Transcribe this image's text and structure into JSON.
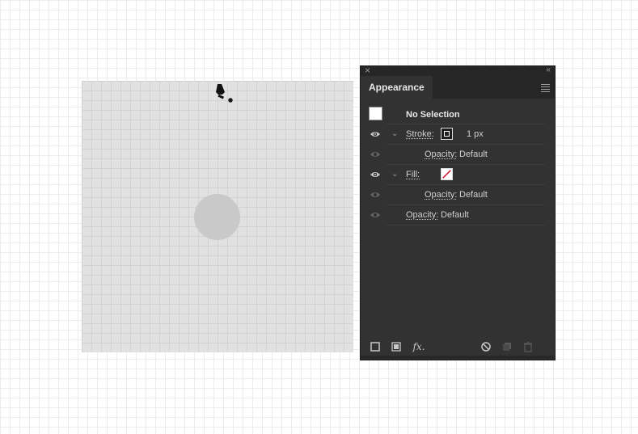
{
  "panel": {
    "tab_label": "Appearance",
    "header": {
      "title": "No Selection"
    },
    "stroke": {
      "label": "Stroke:",
      "weight": "1 px",
      "opacity_label": "Opacity:",
      "opacity_value": "Default"
    },
    "fill": {
      "label": "Fill:",
      "opacity_label": "Opacity:",
      "opacity_value": "Default"
    },
    "global_opacity": {
      "label": "Opacity:",
      "value": "Default"
    },
    "bottom_icons": [
      "add-new-stroke-icon",
      "add-new-fill-icon",
      "add-new-effect-icon",
      "clear-appearance-icon",
      "duplicate-item-icon",
      "delete-item-icon"
    ],
    "fx_label": "fx."
  },
  "colors": {
    "panel_bg": "#323232",
    "fill_none_slash": "#d0021b",
    "text": "#cfcfcf"
  }
}
